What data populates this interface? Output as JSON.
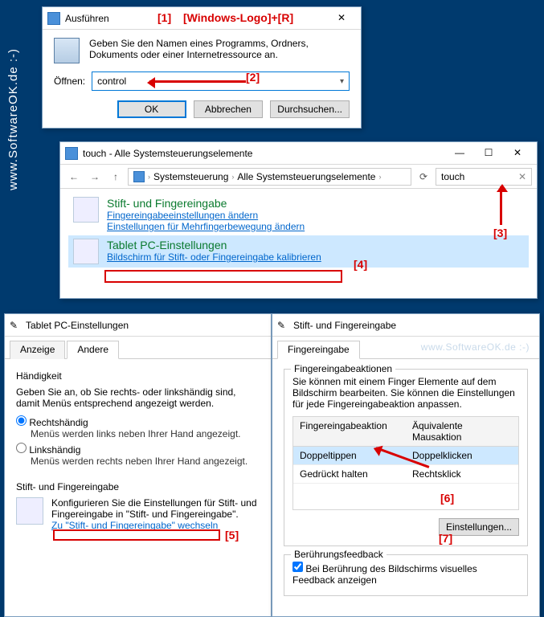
{
  "watermark": "www.SoftwareOK.de :-)",
  "ann": {
    "n1": "[1]",
    "n1_txt": "[Windows-Logo]+[R]",
    "n2": "[2]",
    "n3": "[3]",
    "n4": "[4]",
    "n5": "[5]",
    "n6": "[6]",
    "n7": "[7]"
  },
  "run": {
    "title": "Ausführen",
    "prompt": "Geben Sie den Namen eines Programms, Ordners, Dokuments oder einer Internetressource an.",
    "open_label": "Öffnen:",
    "value": "control",
    "ok": "OK",
    "cancel": "Abbrechen",
    "browse": "Durchsuchen..."
  },
  "cp": {
    "title": "touch - Alle Systemsteuerungselemente",
    "crumb1": "Systemsteuerung",
    "crumb2": "Alle Systemsteuerungselemente",
    "search_value": "touch",
    "item1": {
      "title": "Stift- und Fingereingabe",
      "link1": "Fingereingabeeinstellungen ändern",
      "link2": "Einstellungen für Mehrfingerbewegung ändern"
    },
    "item2": {
      "title": "Tablet PC-Einstellungen",
      "link1": "Bildschirm für Stift- oder Fingereingabe kalibrieren"
    }
  },
  "tablet": {
    "title": "Tablet PC-Einstellungen",
    "tab1": "Anzeige",
    "tab2": "Andere",
    "handedness_title": "Händigkeit",
    "handedness_prompt": "Geben Sie an, ob Sie rechts- oder linkshändig sind, damit Menüs entsprechend angezeigt werden.",
    "right": "Rechtshändig",
    "right_hint": "Menüs werden links neben Ihrer Hand angezeigt.",
    "left": "Linkshändig",
    "left_hint": "Menüs werden rechts neben Ihrer Hand angezeigt.",
    "pen_section": "Stift- und Fingereingabe",
    "pen_prompt": "Konfigurieren Sie die Einstellungen für Stift- und Fingereingabe in \"Stift- und Fingereingabe\".",
    "pen_link": "Zu \"Stift- und Fingereingabe\" wechseln"
  },
  "pen": {
    "title": "Stift- und Fingereingabe",
    "tab1": "Fingereingabe",
    "group_actions": "Fingereingabeaktionen",
    "actions_prompt": "Sie können mit einem Finger Elemente auf dem Bildschirm bearbeiten. Sie können die Einstellungen für jede Fingereingabeaktion anpassen.",
    "col1": "Fingereingabeaktion",
    "col2": "Äquivalente Mausaktion",
    "r1c1": "Doppeltippen",
    "r1c2": "Doppelklicken",
    "r2c1": "Gedrückt halten",
    "r2c2": "Rechtsklick",
    "settings_btn": "Einstellungen...",
    "group_feedback": "Berührungsfeedback",
    "fb_check": "Bei Berührung des Bildschirms visuelles Feedback anzeigen"
  }
}
